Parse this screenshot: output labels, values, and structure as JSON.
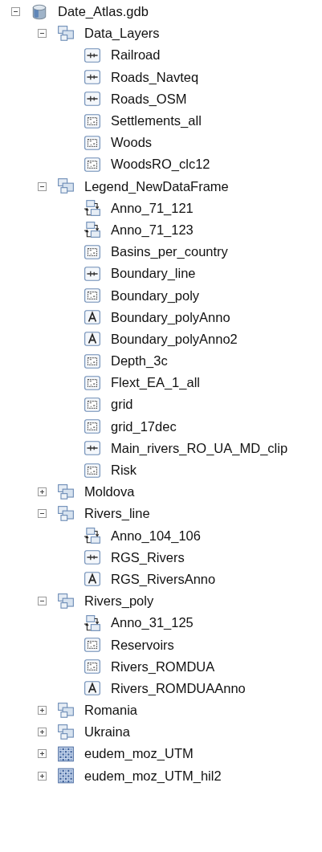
{
  "tree": [
    {
      "label": "Date_Atlas.gdb",
      "kind": "geodatabase",
      "expanded": true,
      "children": [
        {
          "label": "Data_Layers",
          "kind": "feature_dataset",
          "expanded": true,
          "children": [
            {
              "label": "Railroad",
              "kind": "line"
            },
            {
              "label": "Roads_Navteq",
              "kind": "line"
            },
            {
              "label": "Roads_OSM",
              "kind": "line"
            },
            {
              "label": "Settlements_all",
              "kind": "polygon"
            },
            {
              "label": "Woods",
              "kind": "polygon"
            },
            {
              "label": "WoodsRO_clc12",
              "kind": "polygon"
            }
          ]
        },
        {
          "label": "Legend_NewDataFrame",
          "kind": "feature_dataset",
          "expanded": true,
          "children": [
            {
              "label": "Anno_71_121",
              "kind": "relationship"
            },
            {
              "label": "Anno_71_123",
              "kind": "relationship"
            },
            {
              "label": "Basins_per_country",
              "kind": "polygon"
            },
            {
              "label": "Boundary_line",
              "kind": "line"
            },
            {
              "label": "Boundary_poly",
              "kind": "polygon"
            },
            {
              "label": "Boundary_polyAnno",
              "kind": "annotation"
            },
            {
              "label": "Boundary_polyAnno2",
              "kind": "annotation"
            },
            {
              "label": "Depth_3c",
              "kind": "polygon"
            },
            {
              "label": "Flext_EA_1_all",
              "kind": "polygon"
            },
            {
              "label": "grid",
              "kind": "polygon"
            },
            {
              "label": "grid_17dec",
              "kind": "polygon"
            },
            {
              "label": "Main_rivers_RO_UA_MD_clip",
              "kind": "line"
            },
            {
              "label": "Risk",
              "kind": "polygon"
            }
          ]
        },
        {
          "label": "Moldova",
          "kind": "feature_dataset",
          "expanded": false
        },
        {
          "label": "Rivers_line",
          "kind": "feature_dataset",
          "expanded": true,
          "children": [
            {
              "label": "Anno_104_106",
              "kind": "relationship"
            },
            {
              "label": "RGS_Rivers",
              "kind": "line"
            },
            {
              "label": "RGS_RiversAnno",
              "kind": "annotation"
            }
          ]
        },
        {
          "label": "Rivers_poly",
          "kind": "feature_dataset",
          "expanded": true,
          "children": [
            {
              "label": "Anno_31_125",
              "kind": "relationship"
            },
            {
              "label": "Reservoirs",
              "kind": "polygon"
            },
            {
              "label": "Rivers_ROMDUA",
              "kind": "polygon"
            },
            {
              "label": "Rivers_ROMDUAAnno",
              "kind": "annotation"
            }
          ]
        },
        {
          "label": "Romania",
          "kind": "feature_dataset",
          "expanded": false
        },
        {
          "label": "Ukraina",
          "kind": "feature_dataset",
          "expanded": false
        },
        {
          "label": "eudem_moz_UTM",
          "kind": "raster",
          "expanded": false
        },
        {
          "label": "eudem_moz_UTM_hil2",
          "kind": "raster",
          "expanded": false
        }
      ]
    }
  ]
}
